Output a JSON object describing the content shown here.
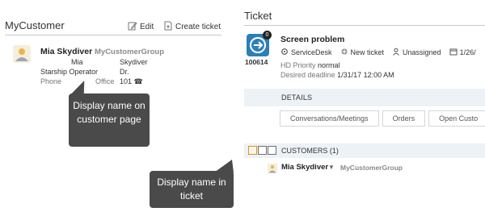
{
  "left_panel": {
    "title": "MyCustomer",
    "actions": {
      "edit": "Edit",
      "create_ticket": "Create ticket"
    },
    "customer": {
      "name": "Mia Skydiver",
      "group": "MyCustomerGroup",
      "fields": {
        "first_name": "Mia",
        "last_name": "Skydiver",
        "title_label": "Starship Operator",
        "salutation": "Dr.",
        "phone_label": "Phone",
        "office_label": "Office",
        "phone_value": "101 ☎"
      }
    }
  },
  "callouts": {
    "customer_page": "Display name on customer page",
    "ticket": "Display name in ticket"
  },
  "ticket": {
    "header": "Ticket",
    "badge": "0",
    "id": "100614",
    "subject": "Screen problem",
    "meta": {
      "queue": "ServiceDesk",
      "state": "New ticket",
      "owner": "Unassigned",
      "date": "1/26/"
    },
    "priority_label": "HD Priority",
    "priority_value": "normal",
    "deadline_label": "Desired deadline",
    "deadline_value": "1/31/17 12:00 AM",
    "details_label": "DETAILS",
    "tabs": [
      "Conversations/Meetings",
      "Orders",
      "Open Custo"
    ],
    "customers_label": "CUSTOMERS (1)",
    "customer_row": {
      "name": "Mia Skydiver",
      "caret": "▼",
      "group": "MyCustomerGroup"
    }
  },
  "colors": {
    "accent_blue": "#2d7fb8",
    "callout_bg": "#4a4a4a",
    "section_bar_bg": "#edf2f7"
  }
}
